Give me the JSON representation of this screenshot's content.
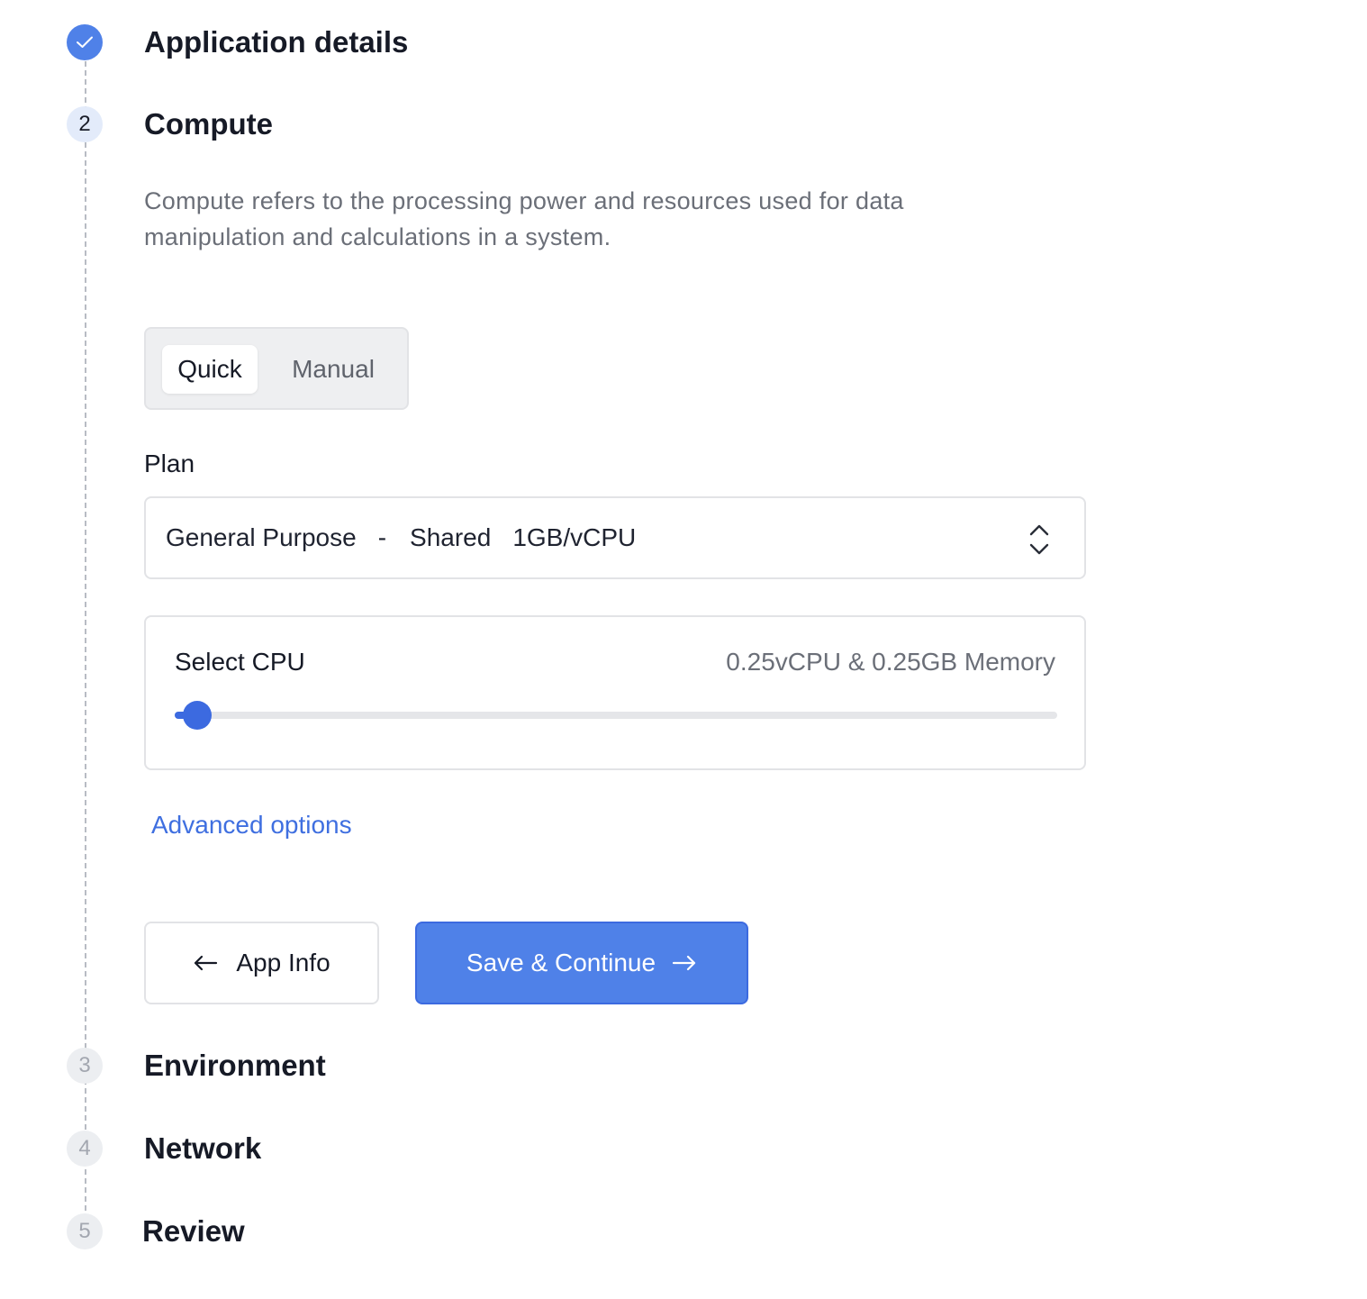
{
  "steps": [
    {
      "number": "",
      "title": "Application details",
      "status": "done",
      "icon": "check-icon"
    },
    {
      "number": "2",
      "title": "Compute",
      "status": "active"
    },
    {
      "number": "3",
      "title": "Environment",
      "status": "pending"
    },
    {
      "number": "4",
      "title": "Network",
      "status": "pending"
    },
    {
      "number": "5",
      "title": "Review",
      "status": "pending"
    }
  ],
  "compute": {
    "description": "Compute refers to the processing power and resources used for data manipulation and calculations in a system.",
    "mode_toggle": {
      "options": [
        "Quick",
        "Manual"
      ],
      "selected": "Quick"
    },
    "plan": {
      "label": "Plan",
      "selected_category": "General Purpose",
      "separator": "-",
      "selected_type": "Shared",
      "selected_ratio": "1GB/vCPU",
      "icon": "chevron-up-down-icon"
    },
    "cpu": {
      "label": "Select CPU",
      "value_text": "0.25vCPU & 0.25GB Memory",
      "slider_fraction": 0.025
    },
    "advanced_link": "Advanced options",
    "back_button": {
      "label": "App Info",
      "icon": "arrow-left-icon"
    },
    "next_button": {
      "label": "Save & Continue",
      "icon": "arrow-right-icon"
    }
  },
  "colors": {
    "accent": "#4f81e8",
    "slider": "#3c6ae0",
    "link": "#3f6fe0"
  }
}
